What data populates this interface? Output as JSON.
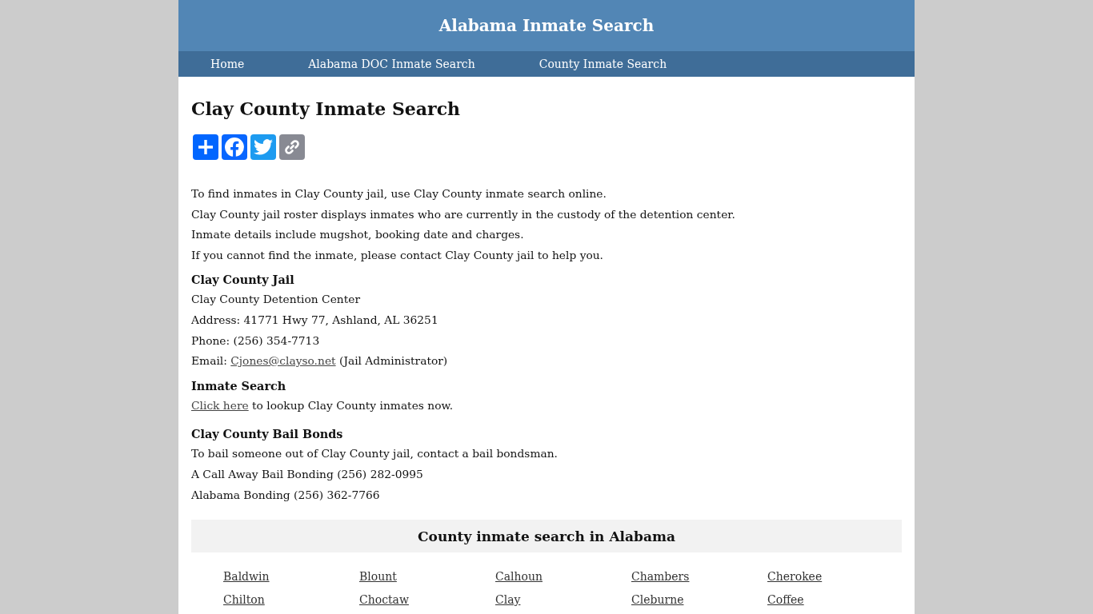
{
  "header": {
    "title": "Alabama Inmate Search"
  },
  "nav": {
    "items": [
      {
        "label": "Home"
      },
      {
        "label": "Alabama DOC Inmate Search"
      },
      {
        "label": "County Inmate Search"
      }
    ]
  },
  "article": {
    "title": "Clay County Inmate Search",
    "share_buttons": [
      {
        "kind": "share"
      },
      {
        "kind": "facebook"
      },
      {
        "kind": "twitter"
      },
      {
        "kind": "copy_link"
      }
    ],
    "intro": [
      "To find inmates in Clay County jail, use Clay County inmate search online.",
      "Clay County jail roster displays inmates who are currently in the custody of the detention center.",
      "Inmate details include mugshot, booking date and charges.",
      "If you cannot find the inmate, please contact Clay County jail to help you."
    ],
    "sections": [
      {
        "heading": "Clay County Jail",
        "lines": [
          [
            {
              "text": "Clay County Detention Center",
              "link": false
            }
          ],
          [
            {
              "text": "Address: 41771 Hwy 77, Ashland, AL 36251",
              "link": false
            }
          ],
          [
            {
              "text": "Phone: (256) 354-7713",
              "link": false
            }
          ],
          [
            {
              "text": "Email: ",
              "link": false
            },
            {
              "text": "Cjones@clayso.net",
              "link": true
            },
            {
              "text": " (Jail Administrator)",
              "link": false
            }
          ]
        ]
      },
      {
        "heading": "Inmate Search",
        "lines": [
          [
            {
              "text": "Click here",
              "link": true
            },
            {
              "text": " to lookup Clay County inmates now.",
              "link": false
            }
          ]
        ]
      },
      {
        "heading": "Clay County Bail Bonds",
        "lines": [
          [
            {
              "text": "To bail someone out of Clay County jail, contact a bail bondsman.",
              "link": false
            }
          ],
          [
            {
              "text": "A Call Away Bail Bonding (256) 282-0995",
              "link": false
            }
          ],
          [
            {
              "text": "Alabama Bonding (256) 362-7766",
              "link": false
            }
          ]
        ]
      }
    ]
  },
  "county_directory": {
    "heading": "County inmate search in Alabama",
    "counties": [
      "Baldwin",
      "Blount",
      "Calhoun",
      "Chambers",
      "Cherokee",
      "Chilton",
      "Choctaw",
      "Clay",
      "Cleburne",
      "Coffee"
    ]
  }
}
